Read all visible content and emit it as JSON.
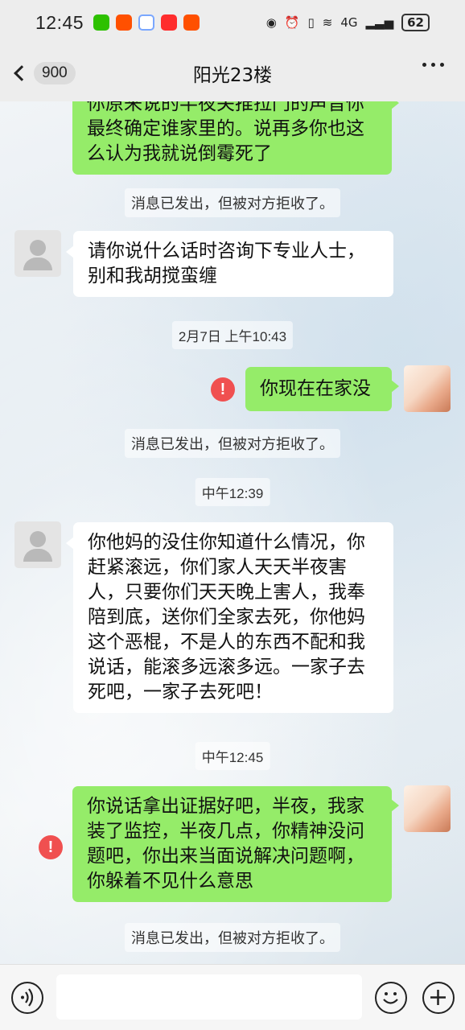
{
  "status_bar": {
    "time": "12:45",
    "network": "4G",
    "battery": "62"
  },
  "nav": {
    "unread_count": "900",
    "title": "阳光23楼"
  },
  "messages": {
    "m1": "你原来说的半夜关推拉门的声音你最终确定谁家里的。说再多你也这么认为我就说倒霉死了",
    "sys1": "消息已发出，但被对方拒收了。",
    "m2": "请你说什么话时咨询下专业人士，别和我胡搅蛮缠",
    "time1": "2月7日 上午10:43",
    "m3": "你现在在家没",
    "sys2": "消息已发出，但被对方拒收了。",
    "time2": "中午12:39",
    "m4": "你他妈的没住你知道什么情况，你赶紧滚远，你们家人天天半夜害人，只要你们天天晚上害人，我奉陪到底，送你们全家去死，你他妈这个恶棍，不是人的东西不配和我说话，能滚多远滚多远。一家子去死吧，一家子去死吧！",
    "time3": "中午12:45",
    "m5": "你说话拿出证据好吧，半夜，我家装了监控，半夜几点，你精神没问题吧，你出来当面说解决问题啊，你躲着不见什么意思",
    "sys3": "消息已发出，但被对方拒收了。",
    "fail_mark": "!"
  },
  "colors": {
    "my_bubble": "#95ec69",
    "other_bubble": "#ffffff",
    "fail_red": "#f05050"
  },
  "input": {
    "placeholder": ""
  }
}
